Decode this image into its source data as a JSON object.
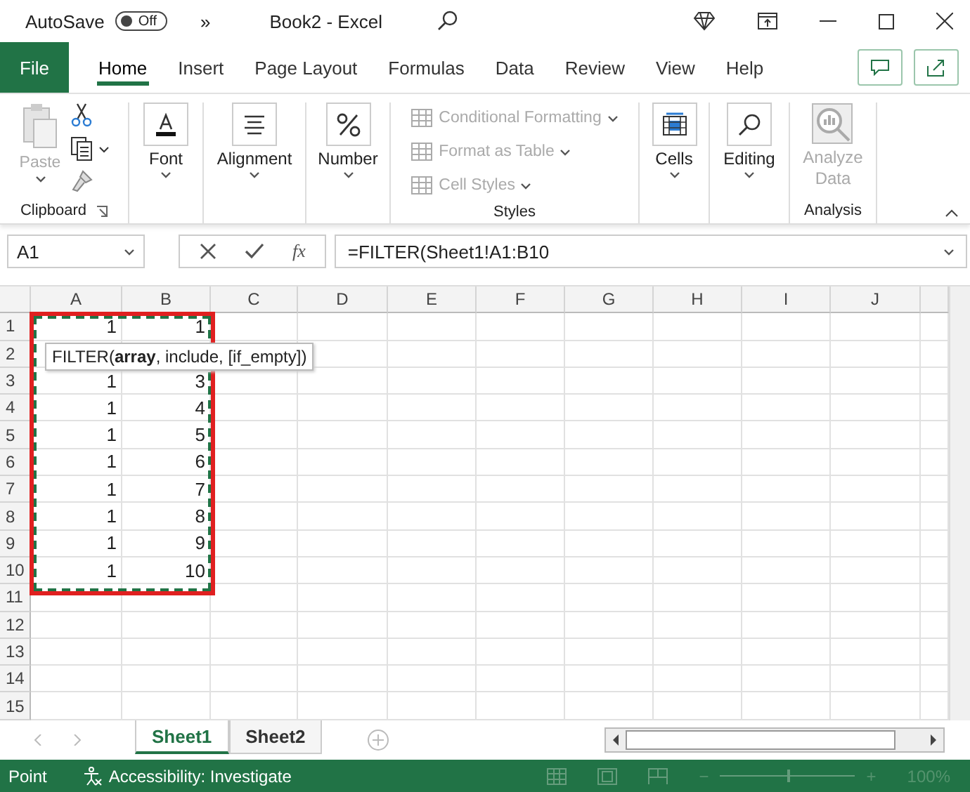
{
  "title_bar": {
    "autosave_label": "AutoSave",
    "autosave_toggle": {
      "label": "Off",
      "on": false
    },
    "overflow": "»",
    "title": "Book2  -  Excel"
  },
  "ribbon_tabs": [
    {
      "label": "File",
      "kind": "file",
      "selected": false
    },
    {
      "label": "Home",
      "kind": "tab",
      "selected": true
    },
    {
      "label": "Insert",
      "kind": "tab",
      "selected": false
    },
    {
      "label": "Page Layout",
      "kind": "tab",
      "selected": false
    },
    {
      "label": "Formulas",
      "kind": "tab",
      "selected": false
    },
    {
      "label": "Data",
      "kind": "tab",
      "selected": false
    },
    {
      "label": "Review",
      "kind": "tab",
      "selected": false
    },
    {
      "label": "View",
      "kind": "tab",
      "selected": false
    },
    {
      "label": "Help",
      "kind": "tab",
      "selected": false
    }
  ],
  "ribbon": {
    "groups": [
      {
        "kind": "clipboard",
        "label": "Clipboard",
        "paste": {
          "label": "Paste",
          "disabled": true
        }
      },
      {
        "kind": "font",
        "button": {
          "label": "Font",
          "disabled": false
        }
      },
      {
        "kind": "alignment",
        "button": {
          "label": "Alignment",
          "disabled": false
        }
      },
      {
        "kind": "number",
        "button": {
          "label": "Number",
          "disabled": false
        }
      },
      {
        "kind": "styles",
        "label": "Styles",
        "items": [
          {
            "label": "Conditional Formatting",
            "disabled": true
          },
          {
            "label": "Format as Table",
            "disabled": true
          },
          {
            "label": "Cell Styles",
            "disabled": true
          }
        ]
      },
      {
        "kind": "cells",
        "button": {
          "label": "Cells",
          "disabled": false
        }
      },
      {
        "kind": "editing",
        "button": {
          "label": "Editing",
          "disabled": false
        }
      },
      {
        "kind": "analysis",
        "label": "Analysis",
        "button": {
          "label": "Analyze\nData",
          "disabled": true
        }
      }
    ]
  },
  "formula_bar": {
    "name_box": "A1",
    "fx": "fx",
    "formula": "=FILTER(Sheet1!A1:B10"
  },
  "sheet": {
    "columns": [
      "A",
      "B",
      "C",
      "D",
      "E",
      "F",
      "G",
      "H",
      "I",
      "J"
    ],
    "rows": [
      {
        "label": "1",
        "cells": [
          "1",
          "1"
        ]
      },
      {
        "label": "2"
      },
      {
        "label": "3",
        "cells": [
          "1",
          "3"
        ]
      },
      {
        "label": "4",
        "cells": [
          "1",
          "4"
        ]
      },
      {
        "label": "5",
        "cells": [
          "1",
          "5"
        ]
      },
      {
        "label": "6",
        "cells": [
          "1",
          "6"
        ]
      },
      {
        "label": "7",
        "cells": [
          "1",
          "7"
        ]
      },
      {
        "label": "8",
        "cells": [
          "1",
          "8"
        ]
      },
      {
        "label": "9",
        "cells": [
          "1",
          "9"
        ]
      },
      {
        "label": "10",
        "cells": [
          "1",
          "10"
        ]
      },
      {
        "label": "11"
      },
      {
        "label": "12"
      },
      {
        "label": "13"
      },
      {
        "label": "14"
      },
      {
        "label": "15"
      }
    ],
    "tooltip": "FILTER(**array**, include, [if_empty])"
  },
  "sheet_tabs": [
    {
      "label": "Sheet1",
      "selected": true
    },
    {
      "label": "Sheet2",
      "selected": false
    }
  ],
  "status_bar": {
    "mode": "Point",
    "accessibility": "Accessibility: Investigate",
    "zoom": {
      "zoom_out": "−",
      "level": 0.5,
      "zoom_in": "+",
      "reading": "100%",
      "disabled": true
    }
  }
}
